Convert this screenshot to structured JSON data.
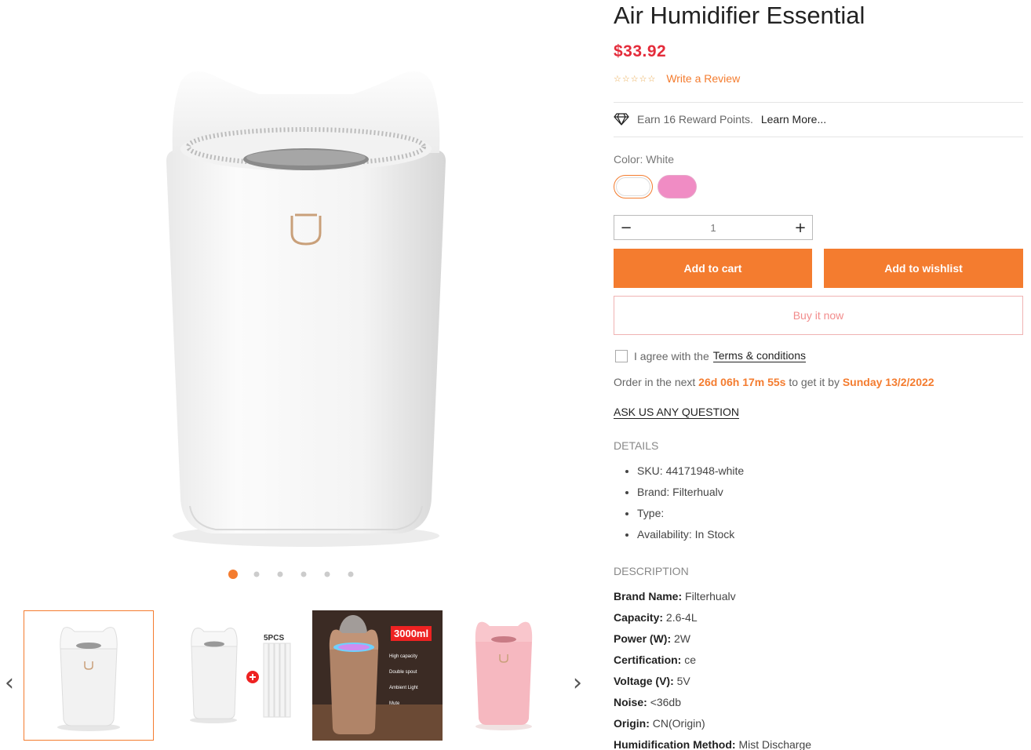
{
  "product": {
    "title": "Air Humidifier Essential",
    "price": "$33.92",
    "stars": "☆☆☆☆☆",
    "write_review": "Write a Review"
  },
  "reward": {
    "text": "Earn 16 Reward Points.",
    "learn_more": "Learn More..."
  },
  "color": {
    "label": "Color: White",
    "options": [
      "White",
      "Pink"
    ],
    "colors": {
      "white": "#ffffff",
      "pink": "#f08cc4"
    }
  },
  "quantity": {
    "minus": "−",
    "value": "1",
    "plus": "+"
  },
  "buttons": {
    "add_to_cart": "Add to cart",
    "add_to_wishlist": "Add to wishlist",
    "buy_now": "Buy it now"
  },
  "agree": {
    "text": "I agree with the",
    "terms": "Terms & conditions"
  },
  "order": {
    "prefix": "Order in the next",
    "countdown": "26d 06h 17m 55s",
    "middle": "to get it by",
    "date": "Sunday 13/2/2022"
  },
  "ask_question": "ASK US ANY QUESTION",
  "details": {
    "heading": "DETAILS",
    "items": [
      "SKU: 44171948-white",
      "Brand: Filterhualv",
      "Type:",
      "Availability: In Stock"
    ]
  },
  "description": {
    "heading": "DESCRIPTION",
    "rows": [
      {
        "key": "Brand Name:",
        "value": "Filterhualv"
      },
      {
        "key": "Capacity:",
        "value": "2.6-4L"
      },
      {
        "key": "Power (W):",
        "value": "2W"
      },
      {
        "key": "Certification:",
        "value": "ce"
      },
      {
        "key": "Voltage (V):",
        "value": "5V"
      },
      {
        "key": "Noise:",
        "value": "<36db"
      },
      {
        "key": "Origin:",
        "value": "CN(Origin)"
      },
      {
        "key": "Humidification Method:",
        "value": "Mist Discharge"
      }
    ]
  },
  "gallery": {
    "slide_count": 6,
    "active_slide": 1,
    "thumb2_label": "5PCS",
    "thumb3_badge": "3000ml",
    "thumb3_features": [
      "High capacity",
      "Double spout",
      "Ambient Light",
      "Mute"
    ],
    "prev_icon": "chevron-left-icon",
    "next_icon": "chevron-right-icon"
  },
  "theme": {
    "accent": "#f47c2f",
    "price_color": "#e42c3b"
  }
}
